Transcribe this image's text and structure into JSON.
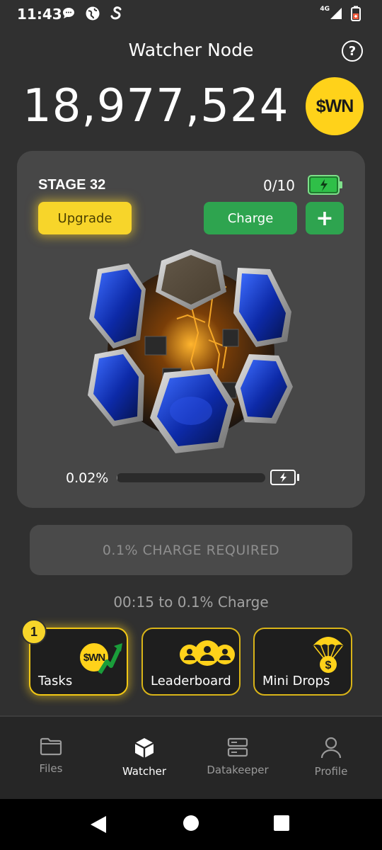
{
  "status_bar": {
    "time": "11:43",
    "left_icons": [
      "chat-bubble-icon",
      "globe-icon",
      "s-logo-icon"
    ],
    "network": "4G",
    "right_icons": [
      "signal-icon",
      "battery-saver-icon"
    ]
  },
  "header": {
    "title": "Watcher Node",
    "help_icon": "question-circle-icon"
  },
  "balance": {
    "amount": "18,977,524",
    "coin_label": "$WN"
  },
  "node_card": {
    "stage": "STAGE 32",
    "charge_count": "0/10",
    "upgrade_label": "Upgrade",
    "charge_label": "Charge",
    "plus_label": "+",
    "progress_text": "0.02%",
    "progress_fraction": 0.0002
  },
  "charge_required": {
    "label": "0.1% CHARGE REQUIRED"
  },
  "timer": {
    "text": "00:15  to 0.1% Charge"
  },
  "tiles": {
    "tasks": {
      "label": "Tasks",
      "badge": "1",
      "coin_label": "$WN"
    },
    "leaderboard": {
      "label": "Leaderboard"
    },
    "mini_drops": {
      "label": "Mini Drops"
    }
  },
  "bottom_nav": {
    "items": [
      {
        "label": "Files",
        "icon": "folder-icon",
        "active": false
      },
      {
        "label": "Watcher",
        "icon": "cube-icon",
        "active": true
      },
      {
        "label": "Datakeeper",
        "icon": "server-icon",
        "active": false
      },
      {
        "label": "Profile",
        "icon": "person-icon",
        "active": false
      }
    ]
  },
  "colors": {
    "background": "#303030",
    "card": "#474747",
    "accent_yellow": "#f7d52a",
    "accent_green": "#2ea44f",
    "nav_bg": "#262626"
  }
}
